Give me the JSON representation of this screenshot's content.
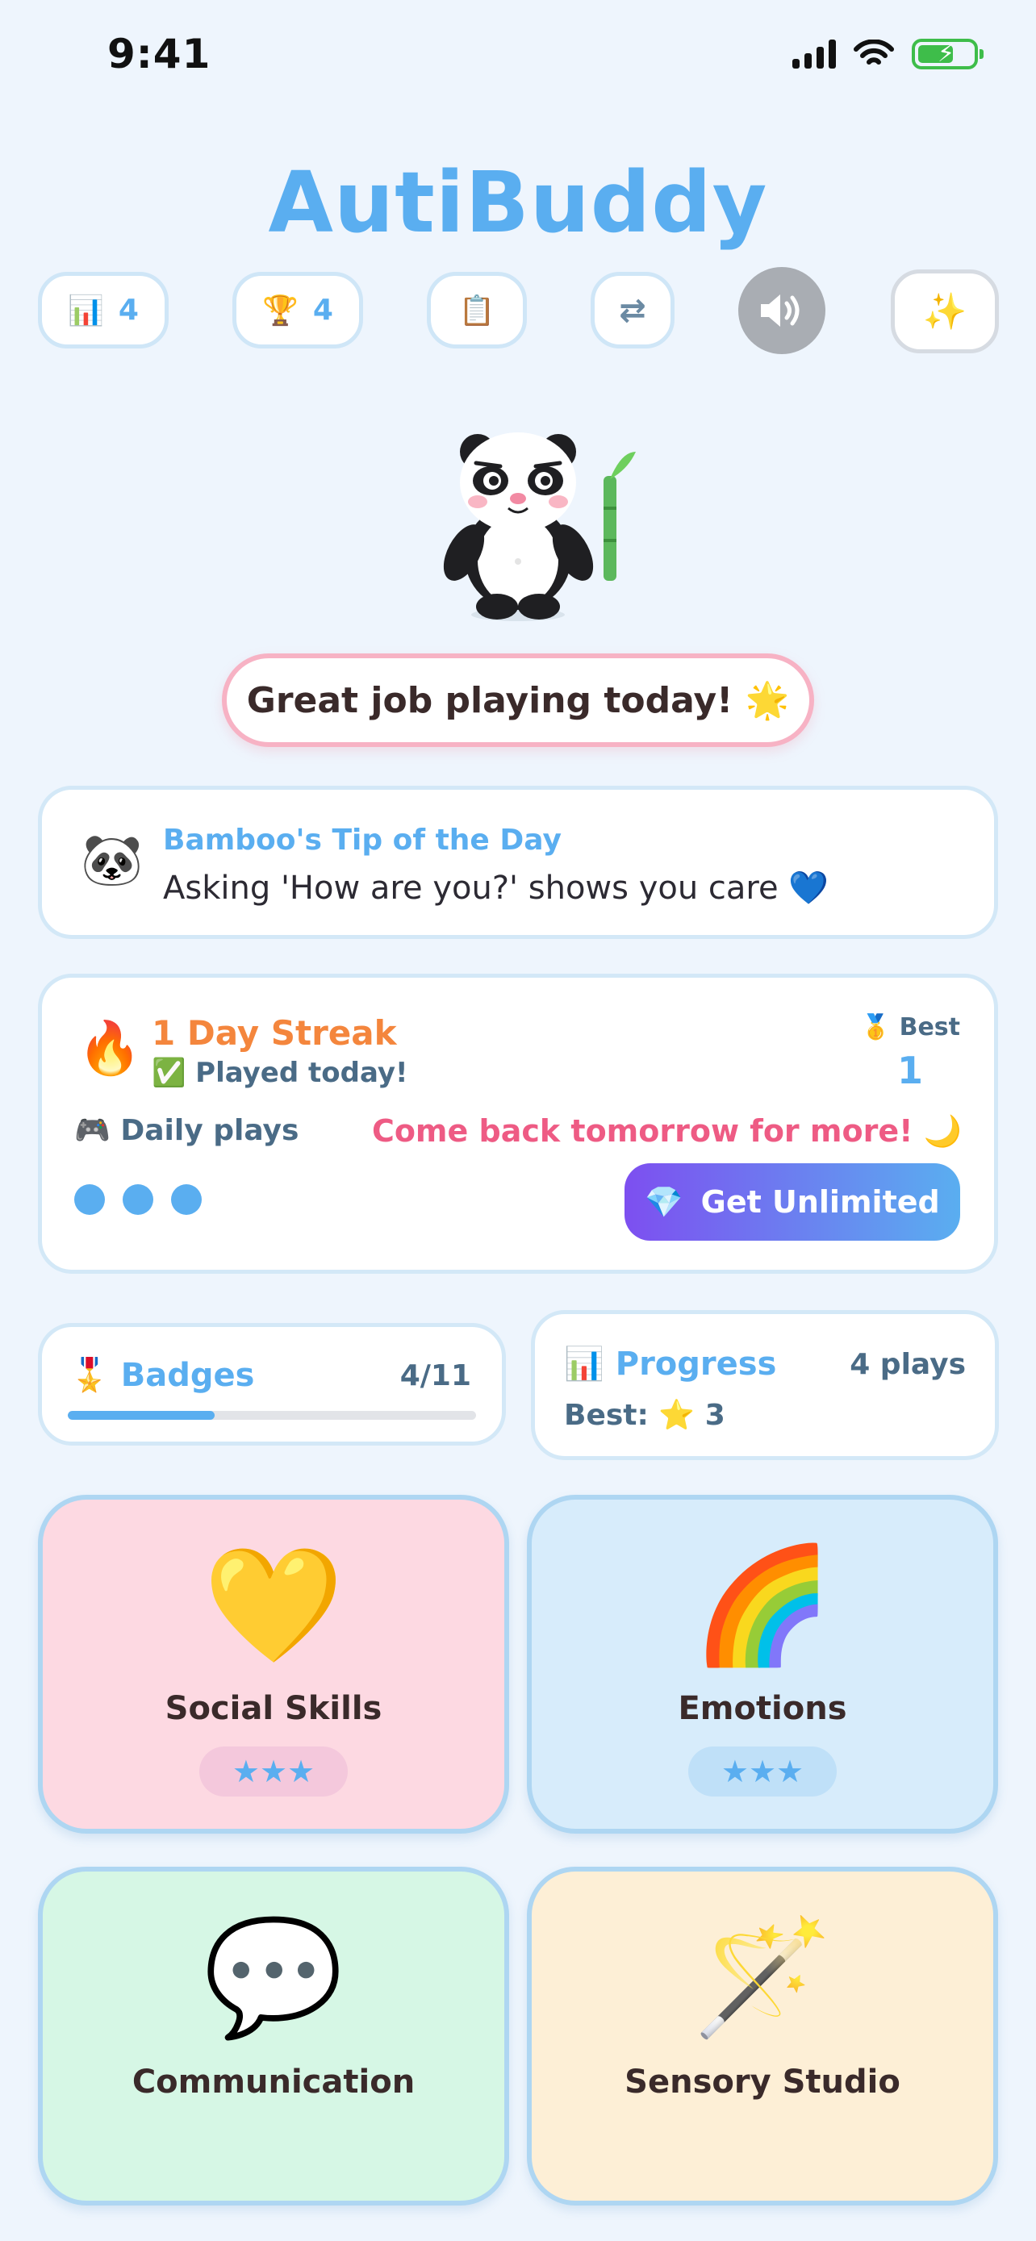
{
  "status": {
    "time": "9:41"
  },
  "app_title": "AutiBuddy",
  "toolbar": {
    "stats_count": "4",
    "trophy_count": "4"
  },
  "bubble": {
    "text": "Great job playing today! 🌟"
  },
  "tip": {
    "title": "Bamboo's Tip of the Day",
    "text": "Asking 'How are you?' shows you care 💙"
  },
  "streak": {
    "title": "1 Day Streak",
    "played": "✅ Played today!",
    "best_label": "Best",
    "best_value": "1",
    "daily_label": "Daily plays",
    "daily_plays_used": 3,
    "come_back": "Come back tomorrow for more! 🌙",
    "unlimited_label": "Get Unlimited"
  },
  "badges": {
    "title": "Badges",
    "count": "4/11",
    "progress_fraction": 0.36
  },
  "progress": {
    "title": "Progress",
    "plays": "4 plays",
    "best": "Best: ⭐ 3"
  },
  "tiles": [
    {
      "label": "Social Skills",
      "emoji": "💛",
      "stars": "★★★",
      "color": "#fdd9e2"
    },
    {
      "label": "Emotions",
      "emoji": "🌈",
      "stars": "★★★",
      "color": "#d7ecfb"
    },
    {
      "label": "Communication",
      "emoji": "💬",
      "color": "#d6f7e5"
    },
    {
      "label": "Sensory Studio",
      "emoji": "🪄",
      "color": "#fdefd6"
    }
  ],
  "colors": {
    "accent": "#5aaef0",
    "streak": "#f4863d",
    "pink": "#ee5b84"
  }
}
